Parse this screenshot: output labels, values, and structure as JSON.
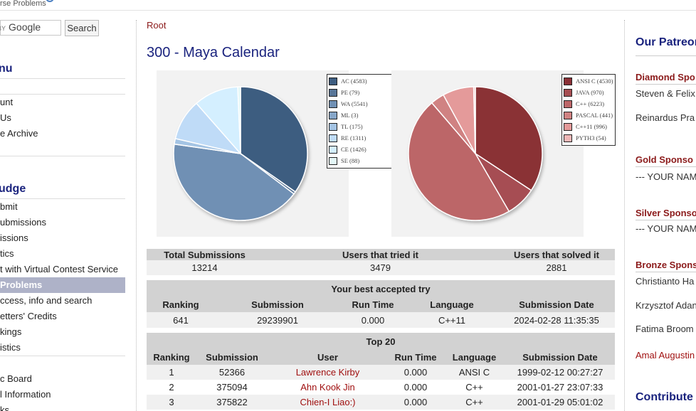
{
  "header": {
    "brand_fragment": "rse Problems"
  },
  "search": {
    "brand_by": "BY",
    "brand_name": "Google",
    "button_label": "Search"
  },
  "left": {
    "heading_menu": "nu",
    "heading_judge": "udge",
    "items_top": [
      "unt",
      "Us",
      "e Archive"
    ],
    "items_judge": [
      "bmit",
      "ubmissions",
      "issions",
      "tics",
      "t with Virtual Contest Service",
      "Problems",
      "ccess, info and search",
      "etters' Credits",
      "kings",
      "istics",
      "",
      "c Board",
      "l Information",
      "ks"
    ]
  },
  "main": {
    "breadcrumb": "Root",
    "title": "300 - Maya Calendar",
    "verdict_legend": [
      {
        "label": "AC (4583)",
        "color": "#3e5d80"
      },
      {
        "label": "PE (79)",
        "color": "#587698"
      },
      {
        "label": "WA (5541)",
        "color": "#7090b4"
      },
      {
        "label": "ML (3)",
        "color": "#86a6c8"
      },
      {
        "label": "TL (175)",
        "color": "#a4c4e4"
      },
      {
        "label": "RE (1311)",
        "color": "#bfdbf7"
      },
      {
        "label": "CE (1426)",
        "color": "#d4efff"
      },
      {
        "label": "SE (88)",
        "color": "#e4f8f8"
      }
    ],
    "language_legend": [
      {
        "label": "ANSI C (4530)",
        "color": "#8a3036"
      },
      {
        "label": "JAVA (970)",
        "color": "#a64e52"
      },
      {
        "label": "C++ (6223)",
        "color": "#bc6668"
      },
      {
        "label": "PASCAL (441)",
        "color": "#d08282"
      },
      {
        "label": "C++11 (996)",
        "color": "#e49a9a"
      },
      {
        "label": "PYTH3 (54)",
        "color": "#f0b8b8"
      }
    ],
    "stats": {
      "headers": [
        "Total Submissions",
        "Users that tried it",
        "Users that solved it"
      ],
      "values": [
        "13214",
        "3479",
        "2881"
      ]
    },
    "best": {
      "caption": "Your best accepted try",
      "headers": [
        "Ranking",
        "Submission",
        "Run Time",
        "Language",
        "Submission Date"
      ],
      "row": [
        "641",
        "29239901",
        "0.000",
        "C++11",
        "2024-02-28 11:35:35"
      ]
    },
    "top": {
      "caption": "Top 20",
      "headers": [
        "Ranking",
        "Submission",
        "User",
        "Run Time",
        "Language",
        "Submission Date"
      ],
      "rows": [
        [
          "1",
          "52366",
          "Lawrence Kirby",
          "0.000",
          "ANSI C",
          "1999-02-12 00:27:27"
        ],
        [
          "2",
          "375094",
          "Ahn Kook Jin",
          "0.000",
          "C++",
          "2001-01-27 23:07:33"
        ],
        [
          "3",
          "375822",
          "Chien-I Liao:)",
          "0.000",
          "C++",
          "2001-01-29 05:01:02"
        ]
      ]
    }
  },
  "right": {
    "title": "Our Patreon",
    "diamond": "Diamond Spo",
    "diamond_names": [
      "Steven & Felix",
      "Reinardus Pra"
    ],
    "gold": "Gold Sponso",
    "gold_text": "--- YOUR NAM",
    "silver": "Silver Sponso",
    "silver_text": "--- YOUR NAM",
    "bronze": "Bronze Spons",
    "bronze_names": [
      "Christianto Ha",
      "Krzysztof Adan",
      "Fatima Broom",
      "Amal Augustin"
    ],
    "contribute": "Contribute"
  },
  "colors": {
    "link": "#a01010",
    "heading": "#1a237e",
    "active_item": "#aeb2c8"
  }
}
